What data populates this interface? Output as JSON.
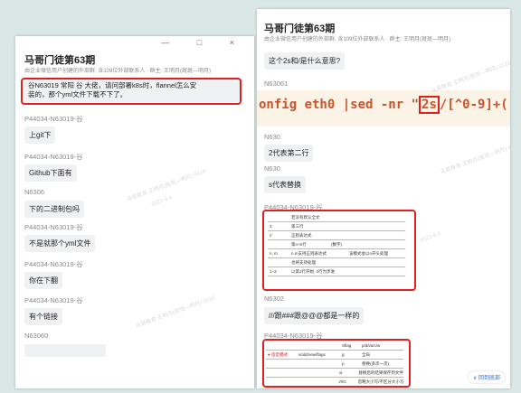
{
  "left": {
    "window_controls": "— □ ×",
    "title": "马哥门徒第63期",
    "subtitle": "由企业微信用户创建的外部群, 含109位外部联系人 · 群主: 王明月(斑斑—明月)",
    "messages": [
      {
        "sender": "",
        "text": "谷N63019 常阳 谷 大佬，请问部署k8s时，flannel这怎么安装的，那个yml文件下载不下了。",
        "line1": "谷N63019 常阳 谷      大佬，请问部署k8s时，flannel怎么安",
        "line2": "装的，那个yml文件下载不下了。"
      },
      {
        "sender": "P44034-N63019-谷",
        "text": "上git下"
      },
      {
        "sender": "P44034-N63019-谷",
        "text": "Github下面有"
      },
      {
        "sender": "N6306",
        "text": "下的二进制包吗"
      },
      {
        "sender": "P44034-N63019-谷",
        "text": "不是就那个yml文件"
      },
      {
        "sender": "P44034-N63019-谷",
        "text": "你在下翻"
      },
      {
        "sender": "P44034-N63019-谷",
        "text": "有个链接"
      },
      {
        "sender": "N63060",
        "text": ""
      }
    ],
    "watermarks": [
      "马哥教育 王明月(斑斑—明月) 9216",
      "2022-9-5"
    ]
  },
  "right": {
    "title": "马哥门徒第63期",
    "subtitle": "由企业微信用户创建的外部群, 含109位外部联系人 · 群主: 王明月(斑斑—明月)",
    "q1": "这个2s和/是什么意思?",
    "sender1": "N63061",
    "code_pre": "onfig eth0 |sed -nr  \"",
    "code_hl": "2s",
    "code_post": "/[^0-9]+(",
    "sender2": "N630",
    "msg2": "2代表第二行",
    "sender3": "N630",
    "msg3": "s代表替换",
    "sender4": "P44034-N63019-谷",
    "table_rows": [
      [
        "",
        "若没有默认全文"
      ],
      [
        "3",
        "第三行"
      ],
      [
        "//",
        "正则表达式"
      ],
      [
        "",
        "第n-m行",
        "(数字)"
      ],
      [
        "n, m",
        "n,m支持正则表达式",
        "该模式会以n开头处理"
      ],
      [
        "",
        "也将支持处理"
      ],
      [
        "1~2",
        "以第1行开始, 2行为步进"
      ]
    ],
    "sender5": "N6302",
    "msg5": "///跟###跟@@@都是一样的",
    "sender6": "P44034-N63019-谷",
    "bottom_rows": [
      [
        "",
        "",
        "Sflag",
        "p/d/i/a/c/w"
      ],
      [
        "● 指定模式",
        "s/old/new/flags",
        "g",
        "全局"
      ],
      [
        "",
        "",
        "p",
        "替换(多次一次)"
      ],
      [
        "",
        "",
        "w",
        "替换后的结果保存到文件"
      ],
      [
        "",
        "",
        "i/I/G",
        "忽略大小写/不区分大小写"
      ]
    ],
    "collapse_label": "∨ 回到底部"
  },
  "colors": {
    "background": "#d9e8e6",
    "highlight": "#e02020",
    "code": "#c9542c",
    "bubble": "#f0f1f3"
  }
}
